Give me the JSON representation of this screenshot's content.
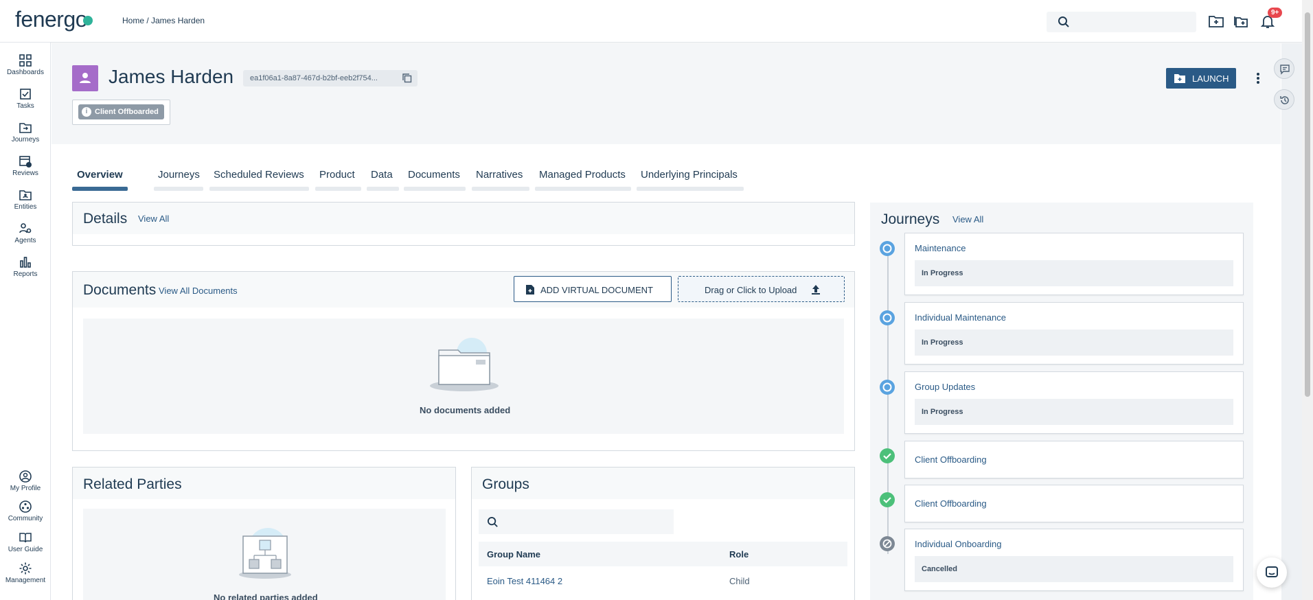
{
  "brand": {
    "logo": "fenergo"
  },
  "breadcrumb": "Home / James Harden",
  "notifications": {
    "badge": "9+"
  },
  "sidebar": {
    "top": [
      {
        "label": "Dashboards"
      },
      {
        "label": "Tasks"
      },
      {
        "label": "Journeys"
      },
      {
        "label": "Reviews"
      },
      {
        "label": "Entities"
      },
      {
        "label": "Agents"
      },
      {
        "label": "Reports"
      }
    ],
    "bottom": [
      {
        "label": "My Profile"
      },
      {
        "label": "Community"
      },
      {
        "label": "User Guide"
      },
      {
        "label": "Management"
      }
    ]
  },
  "entity": {
    "name": "James Harden",
    "id": "ea1f06a1-8a87-467d-b2bf-eeb2f754...",
    "status": "Client Offboarded",
    "launch_label": "LAUNCH"
  },
  "tabs": [
    {
      "label": "Overview"
    },
    {
      "label": "Journeys"
    },
    {
      "label": "Scheduled Reviews"
    },
    {
      "label": "Product"
    },
    {
      "label": "Data"
    },
    {
      "label": "Documents"
    },
    {
      "label": "Narratives"
    },
    {
      "label": "Managed Products"
    },
    {
      "label": "Underlying Principals"
    }
  ],
  "details": {
    "title": "Details",
    "view_all": "View All"
  },
  "documents": {
    "title": "Documents",
    "view_all": "View All Documents",
    "add_virtual": "ADD VIRTUAL DOCUMENT",
    "upload": "Drag or Click to Upload",
    "empty": "No documents added"
  },
  "related": {
    "title": "Related Parties",
    "empty": "No related parties added"
  },
  "groups": {
    "title": "Groups",
    "columns": [
      "Group Name",
      "Role"
    ],
    "rows": [
      {
        "name": "Eoin Test 411464 2",
        "role": "Child"
      }
    ]
  },
  "journeys": {
    "title": "Journeys",
    "view_all": "View All",
    "items": [
      {
        "name": "Maintenance",
        "status": "In Progress",
        "state": "progress"
      },
      {
        "name": "Individual Maintenance",
        "status": "In Progress",
        "state": "progress"
      },
      {
        "name": "Group Updates",
        "status": "In Progress",
        "state": "progress"
      },
      {
        "name": "Client Offboarding",
        "status": "",
        "state": "done"
      },
      {
        "name": "Client Offboarding",
        "status": "",
        "state": "done"
      },
      {
        "name": "Individual Onboarding",
        "status": "Cancelled",
        "state": "cancelled"
      }
    ]
  },
  "colors": {
    "primary": "#2a5a86",
    "avatar": "#a56cc9",
    "done": "#4cc07a",
    "progress": "#5aa3e0",
    "cancelled": "#7d8894"
  }
}
